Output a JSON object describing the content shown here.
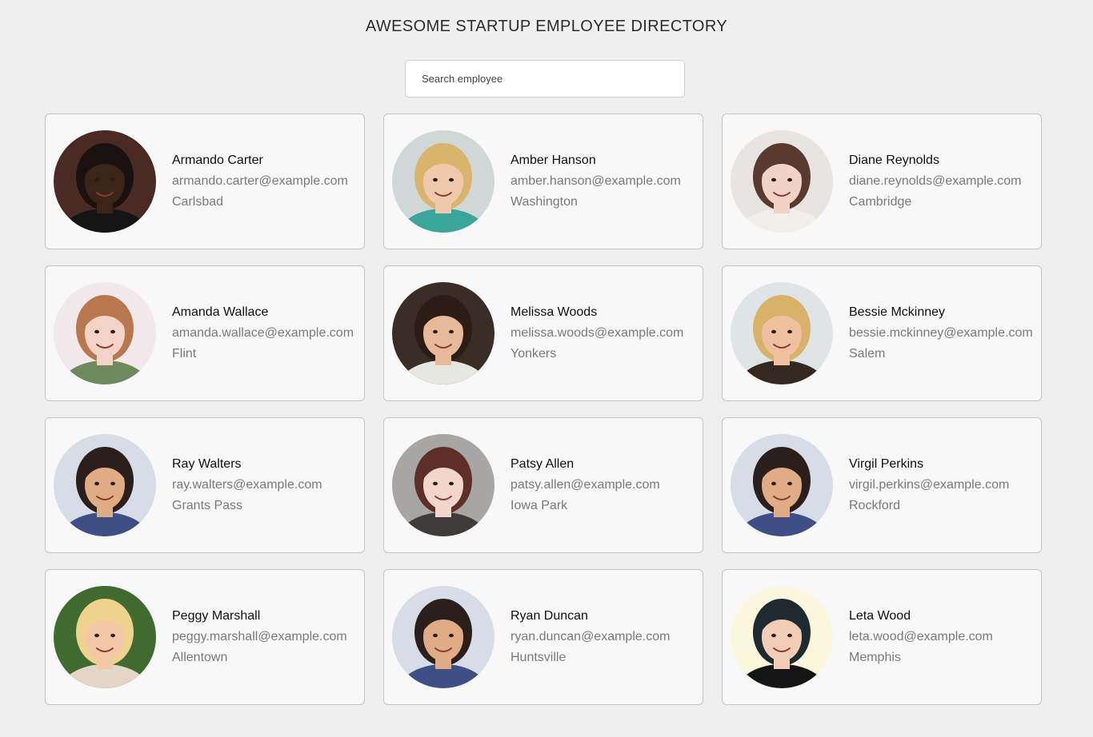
{
  "header": {
    "title": "AWESOME STARTUP EMPLOYEE DIRECTORY"
  },
  "search": {
    "placeholder": "Search employee",
    "value": ""
  },
  "employees": [
    {
      "name": "Armando Carter",
      "email": "armando.carter@example.com",
      "city": "Carlsbad",
      "avatar": {
        "bg": "#4a2a22",
        "skin": "#3b2418",
        "hair": "#1a1210",
        "shirt": "#151515"
      }
    },
    {
      "name": "Amber Hanson",
      "email": "amber.hanson@example.com",
      "city": "Washington",
      "avatar": {
        "bg": "#cfd8d6",
        "skin": "#f0c9ad",
        "hair": "#d9b46c",
        "shirt": "#3aa59b"
      }
    },
    {
      "name": "Diane Reynolds",
      "email": "diane.reynolds@example.com",
      "city": "Cambridge",
      "avatar": {
        "bg": "#e7e4e2",
        "skin": "#f1d2c4",
        "hair": "#5a3a2c",
        "shirt": "#f2efea"
      }
    },
    {
      "name": "Amanda Wallace",
      "email": "amanda.wallace@example.com",
      "city": "Flint",
      "avatar": {
        "bg": "#f1e9ec",
        "skin": "#f3d3c6",
        "hair": "#b9774e",
        "shirt": "#6d8a5c"
      }
    },
    {
      "name": "Melissa Woods",
      "email": "melissa.woods@example.com",
      "city": "Yonkers",
      "avatar": {
        "bg": "#3a2d26",
        "skin": "#e5b99a",
        "hair": "#2b1d16",
        "shirt": "#e7e7e2"
      }
    },
    {
      "name": "Bessie Mckinney",
      "email": "bessie.mckinney@example.com",
      "city": "Salem",
      "avatar": {
        "bg": "#dfe4e6",
        "skin": "#eec09d",
        "hair": "#d8b269",
        "shirt": "#332920"
      }
    },
    {
      "name": "Ray Walters",
      "email": "ray.walters@example.com",
      "city": "Grants Pass",
      "avatar": {
        "bg": "#d6dde6",
        "skin": "#e0ac85",
        "hair": "#2a1f1a",
        "shirt": "#3e4f86"
      }
    },
    {
      "name": "Patsy Allen",
      "email": "patsy.allen@example.com",
      "city": "Iowa Park",
      "avatar": {
        "bg": "#a8a6a4",
        "skin": "#f2d6c9",
        "hair": "#5e2f27",
        "shirt": "#3f3b3a"
      }
    },
    {
      "name": "Virgil Perkins",
      "email": "virgil.perkins@example.com",
      "city": "Rockford",
      "avatar": {
        "bg": "#d6dde6",
        "skin": "#e0ac85",
        "hair": "#2a1f1a",
        "shirt": "#3e4f86"
      }
    },
    {
      "name": "Peggy Marshall",
      "email": "peggy.marshall@example.com",
      "city": "Allentown",
      "avatar": {
        "bg": "#3f6b30",
        "skin": "#f2c8a7",
        "hair": "#efd38c",
        "shirt": "#e4d6c4"
      }
    },
    {
      "name": "Ryan Duncan",
      "email": "ryan.duncan@example.com",
      "city": "Huntsville",
      "avatar": {
        "bg": "#d6dde6",
        "skin": "#e0ac85",
        "hair": "#2a1f1a",
        "shirt": "#3e4f86"
      }
    },
    {
      "name": "Leta Wood",
      "email": "leta.wood@example.com",
      "city": "Memphis",
      "avatar": {
        "bg": "#fbf7dc",
        "skin": "#f1cdb6",
        "hair": "#1d2a30",
        "shirt": "#151515"
      }
    }
  ]
}
